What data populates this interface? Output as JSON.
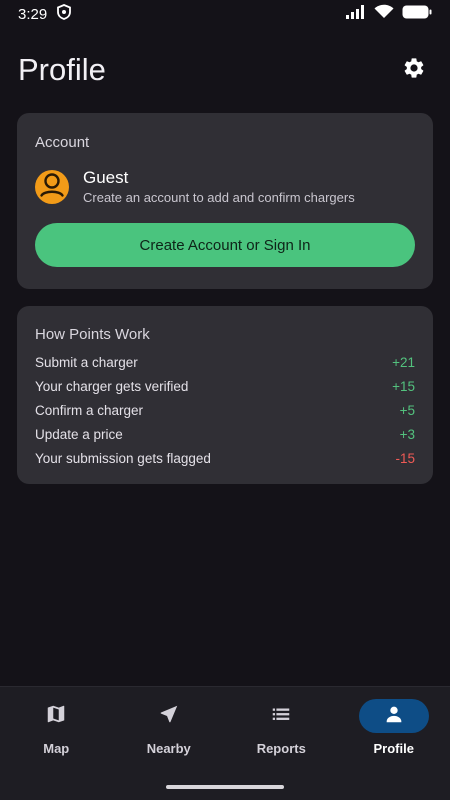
{
  "status_bar": {
    "time": "3:29"
  },
  "header": {
    "title": "Profile"
  },
  "account": {
    "title": "Account",
    "name": "Guest",
    "subtitle": "Create an account to add and confirm chargers",
    "cta_label": "Create Account or Sign In"
  },
  "points": {
    "title": "How Points Work",
    "rows": [
      {
        "label": "Submit a charger",
        "value": "+21"
      },
      {
        "label": "Your charger gets verified",
        "value": "+15"
      },
      {
        "label": "Confirm a charger",
        "value": "+5"
      },
      {
        "label": "Update a price",
        "value": "+3"
      },
      {
        "label": "Your submission gets flagged",
        "value": "-15"
      }
    ]
  },
  "nav": {
    "items": [
      {
        "label": "Map",
        "icon": "map-icon"
      },
      {
        "label": "Nearby",
        "icon": "navigation-arrow-icon"
      },
      {
        "label": "Reports",
        "icon": "list-icon"
      },
      {
        "label": "Profile",
        "icon": "person-icon"
      }
    ],
    "active": "Profile"
  },
  "colors": {
    "background": "#141218",
    "card": "#302f35",
    "accent_green": "#4ac47e",
    "positive": "#53c27e",
    "negative": "#ef5a55",
    "active_nav": "#0e4d86",
    "avatar": "#f29b18"
  }
}
